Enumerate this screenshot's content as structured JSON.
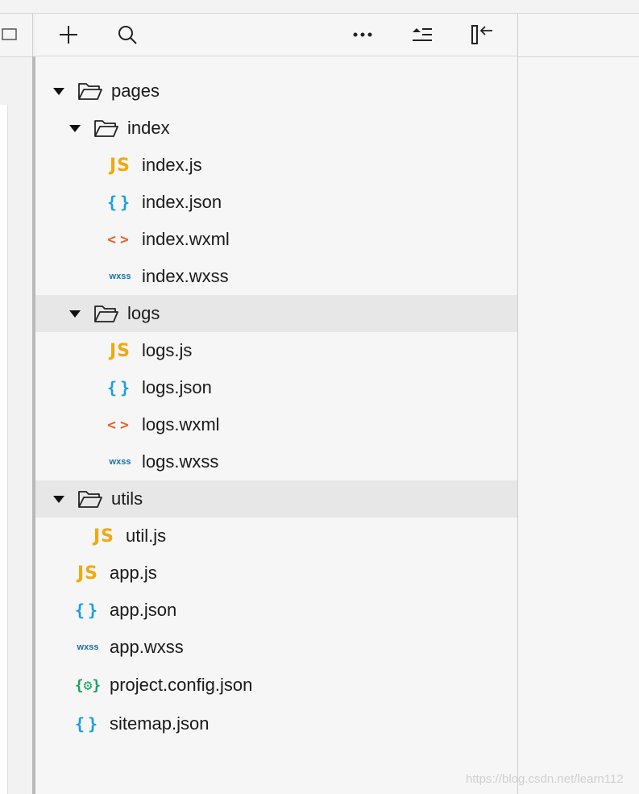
{
  "toolbar": {
    "buttons": [
      "add",
      "search",
      "more",
      "collapse-all",
      "hide-sidebar"
    ]
  },
  "tree": {
    "pages": "pages",
    "index": "index",
    "index_js": "index.js",
    "index_json": "index.json",
    "index_wxml": "index.wxml",
    "index_wxss": "index.wxss",
    "logs": "logs",
    "logs_js": "logs.js",
    "logs_json": "logs.json",
    "logs_wxml": "logs.wxml",
    "logs_wxss": "logs.wxss",
    "utils": "utils",
    "util_js": "util.js",
    "app_js": "app.js",
    "app_json": "app.json",
    "app_wxss": "app.wxss",
    "project_config": "project.config.json",
    "sitemap": "sitemap.json"
  },
  "icons": {
    "js": "JS",
    "json": "{}",
    "wxml": "<>",
    "wxss": "wxss",
    "config": "{⚙}"
  },
  "colors": {
    "js": "#f0a90e",
    "json": "#1b9fe0",
    "wxml": "#e8602c",
    "wxss": "#1a6fb5",
    "config": "#17a45a"
  },
  "watermark": "https://blog.csdn.net/learn112"
}
